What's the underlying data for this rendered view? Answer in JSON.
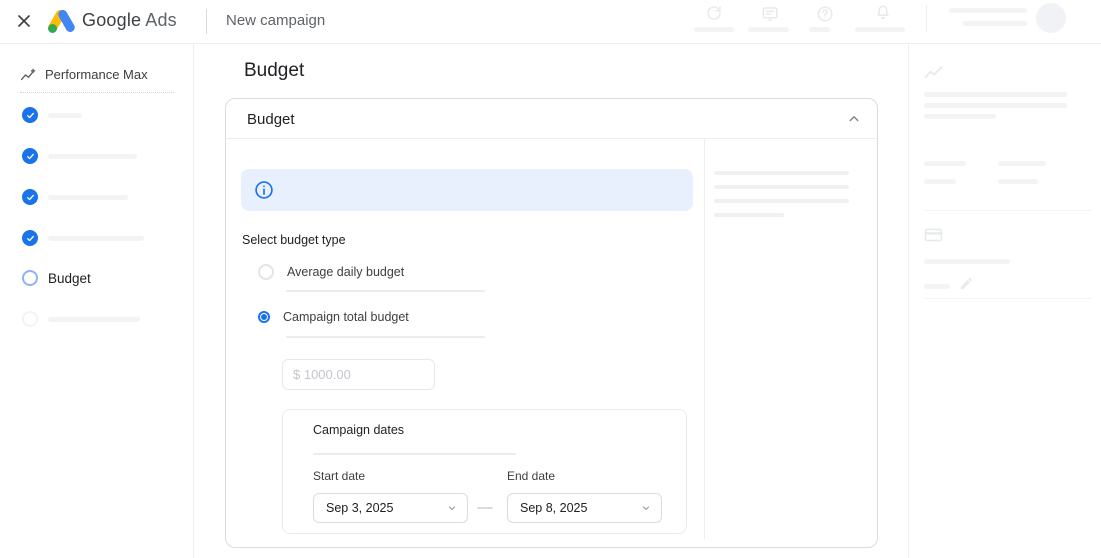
{
  "colors": {
    "accent_blue": "#1a73e8",
    "banner_bg": "#e8f0fe",
    "logo_yellow": "#fbbc04",
    "logo_blue": "#4285f4",
    "logo_green": "#34a853",
    "border_gray": "#dadce0",
    "skeleton_gray": "#f1f3f4"
  },
  "topbar": {
    "brand_google": "Google",
    "brand_ads": "Ads",
    "page_title": "New campaign",
    "icons": [
      "close-icon",
      "refresh-icon",
      "feedback-icon",
      "help-icon",
      "bell-icon",
      "avatar"
    ]
  },
  "sidebar": {
    "campaign_type": "Performance Max",
    "campaign_type_icon": "trending-icon",
    "steps": [
      {
        "state": "completed",
        "label": ""
      },
      {
        "state": "completed",
        "label": ""
      },
      {
        "state": "completed",
        "label": ""
      },
      {
        "state": "completed",
        "label": ""
      },
      {
        "state": "current",
        "label": "Budget"
      },
      {
        "state": "upcoming",
        "label": ""
      }
    ]
  },
  "main": {
    "heading": "Budget",
    "card": {
      "title": "Budget",
      "collapse_icon": "chevron-up-icon",
      "banner_icon": "info-icon",
      "select_budget_type": "Select budget type",
      "options": [
        {
          "label": "Average daily budget",
          "selected": false
        },
        {
          "label": "Campaign total budget",
          "selected": true
        }
      ],
      "amount_placeholder": "$ 1000.00",
      "dates": {
        "title": "Campaign dates",
        "start_label": "Start date",
        "start_value": "Sep 3, 2025",
        "end_label": "End date",
        "end_value": "Sep 8, 2025"
      }
    }
  },
  "right_panel": {
    "icons": [
      "trending-icon",
      "credit-card-icon",
      "pencil-icon"
    ]
  }
}
